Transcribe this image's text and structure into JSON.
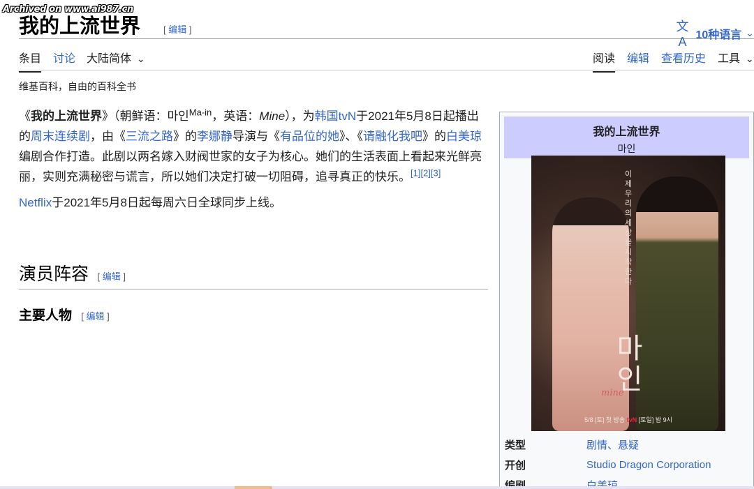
{
  "watermark": "Archived on www.ai987.cn",
  "header": {
    "title": "我的上流世界",
    "edit_label": "编辑",
    "languages_label": "10种语言",
    "lang_icon": "文A"
  },
  "tabs": {
    "left": [
      "条目",
      "讨论",
      "大陆简体"
    ],
    "right": [
      "阅读",
      "编辑",
      "查看历史",
      "工具"
    ]
  },
  "tagline": "维基百科，自由的百科全书",
  "article": {
    "p1": [
      "《",
      "我的上流世界",
      "》（朝鲜语：마인",
      "Ma-in",
      "，英语：",
      "Mine",
      "），为",
      "韩国tvN",
      "于2021年5月8日起播出的",
      "周末连续剧",
      "，由《",
      "三流之路",
      "》的",
      "李娜静",
      "导演与《",
      "有品位的她",
      "》、《",
      "请融化我吧",
      "》的",
      "白美琼",
      "编剧合作打造。此剧以两名嫁入财阀世家的女子为核心。她们的生活表面上看起来光鲜亮丽，实则充满秘密与谎言，所以她们决定打破一切阻碍，追寻真正的快乐。",
      "[1][2][3]"
    ],
    "p2": [
      "Netflix",
      "于2021年5月8日起每周六日全球同步上线。"
    ]
  },
  "sections": {
    "cast_heading": "演员阵容",
    "main_heading": "主要人物",
    "edit_label": "编辑"
  },
  "infobox": {
    "title": "我的上流世界",
    "subtitle": "마인",
    "poster": {
      "vertical_text": "이제 우리의 세상을 시작한다",
      "big_title": "마인",
      "mine_logo": "mine",
      "date_line": "5/8 [토] 첫 방송",
      "channel": "tvN",
      "time_line": "[토일] 밤 9시"
    },
    "rows": [
      {
        "key": "类型",
        "value": "剧情、悬疑"
      },
      {
        "key": "开创",
        "value": "Studio Dragon Corporation"
      },
      {
        "key": "编剧",
        "value": "白美琼"
      }
    ]
  },
  "colors": {
    "link": "#3366cc",
    "infobox_header": "#ccccff",
    "text": "#202122"
  }
}
